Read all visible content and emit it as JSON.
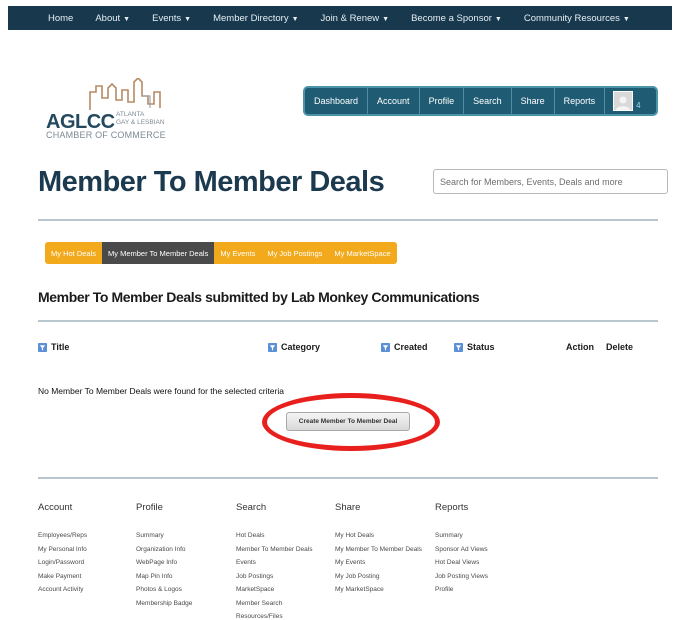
{
  "top_nav": [
    {
      "label": "Home",
      "caret": false
    },
    {
      "label": "About",
      "caret": true
    },
    {
      "label": "Events",
      "caret": true
    },
    {
      "label": "Member Directory",
      "caret": true
    },
    {
      "label": "Join & Renew",
      "caret": true
    },
    {
      "label": "Become a Sponsor",
      "caret": true
    },
    {
      "label": "Community Resources",
      "caret": true
    }
  ],
  "logo": {
    "letters": "AGLCC",
    "sub_line1": "ATLANTA",
    "sub_line2": "GAY & LESBIAN",
    "chamber": "CHAMBER OF COMMERCE"
  },
  "user_nav": [
    "Dashboard",
    "Account",
    "Profile",
    "Search",
    "Share",
    "Reports"
  ],
  "user_badge_count": "4",
  "page_title": "Member To Member Deals",
  "search": {
    "placeholder": "Search for Members, Events, Deals and more"
  },
  "tabs": [
    {
      "label": "My Hot Deals",
      "active": false
    },
    {
      "label": "My Member To Member Deals",
      "active": true
    },
    {
      "label": "My Events",
      "active": false
    },
    {
      "label": "My Job Postings",
      "active": false
    },
    {
      "label": "My MarketSpace",
      "active": false
    }
  ],
  "subtitle": "Member To Member Deals submitted by Lab Monkey Communications",
  "table_headers": {
    "title": "Title",
    "category": "Category",
    "created": "Created",
    "status": "Status",
    "action": "Action",
    "delete": "Delete"
  },
  "empty_message": "No Member To Member Deals were found for the selected criteria",
  "create_button": "Create Member To Member Deal",
  "colors": {
    "top_nav": "#17384d",
    "user_nav": "#1f5c73",
    "tab_orange": "#f2a91c",
    "tab_active": "#4a4a4a",
    "highlight": "#e8201d"
  },
  "footer": [
    {
      "heading": "Account",
      "links": [
        "Employees/Reps",
        "My Personal Info",
        "Login/Password",
        "Make Payment",
        "Account Activity"
      ]
    },
    {
      "heading": "Profile",
      "links": [
        "Summary",
        "Organization Info",
        "WebPage Info",
        "Map Pin Info",
        "Photos & Logos",
        "Membership Badge"
      ]
    },
    {
      "heading": "Search",
      "links": [
        "Hot Deals",
        "Member To Member Deals",
        "Events",
        "Job Postings",
        "MarketSpace",
        "Member Search",
        "Resources/Files"
      ]
    },
    {
      "heading": "Share",
      "links": [
        "My Hot Deals",
        "My Member To Member Deals",
        "My Events",
        "My Job Posting",
        "My MarketSpace"
      ]
    },
    {
      "heading": "Reports",
      "links": [
        "Summary",
        "Sponsor Ad Views",
        "Hot Deal Views",
        "Job Posting Views",
        "Profile"
      ]
    }
  ]
}
